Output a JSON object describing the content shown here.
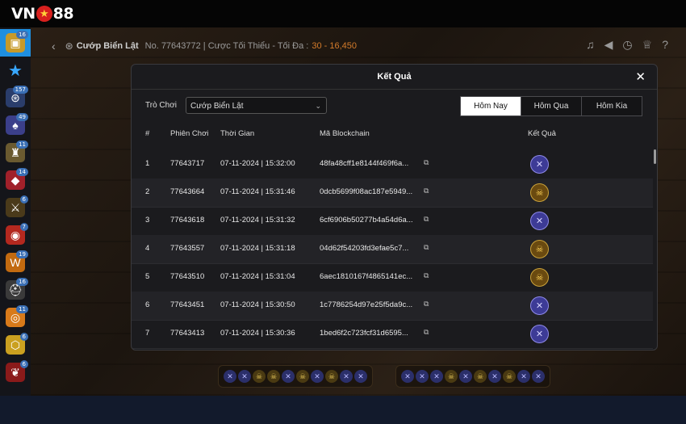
{
  "app": {
    "logo_left": "VN",
    "logo_right": "88"
  },
  "sidebar": {
    "items": [
      {
        "icon": "game-chest-icon",
        "badge": "16",
        "active": true
      },
      {
        "icon": "star-icon",
        "badge": "",
        "active": false
      },
      {
        "icon": "gamepad-icon",
        "badge": "157",
        "active": false
      },
      {
        "icon": "card-game-icon",
        "badge": "49",
        "active": false
      },
      {
        "icon": "warrior-icon",
        "badge": "11",
        "active": false
      },
      {
        "icon": "diamond-game-icon",
        "badge": "14",
        "active": false
      },
      {
        "icon": "battle-game-icon",
        "badge": "6",
        "active": false
      },
      {
        "icon": "dota-icon",
        "badge": "7",
        "active": false
      },
      {
        "icon": "warcraft-icon",
        "badge": "19",
        "active": false
      },
      {
        "icon": "pubg-icon",
        "badge": "16",
        "active": false
      },
      {
        "icon": "overwatch-icon",
        "badge": "11",
        "active": false
      },
      {
        "icon": "rainbow-six-icon",
        "badge": "6",
        "active": false
      },
      {
        "icon": "dragon-icon",
        "badge": "6",
        "active": false
      }
    ]
  },
  "game_header": {
    "game_name": "Cướp Biển Lật",
    "session_text": "No. 77643772 | Cược Tối Thiểu - Tối Đa :",
    "bet_range": "30 - 16,450"
  },
  "modal": {
    "title": "Kết Quả",
    "filter_label": "Trò Chơi",
    "selected_game": "Cướp Biển Lật",
    "tabs": [
      {
        "label": "Hôm Nay",
        "active": true
      },
      {
        "label": "Hôm Qua",
        "active": false
      },
      {
        "label": "Hôm Kia",
        "active": false
      }
    ],
    "columns": {
      "idx": "#",
      "session": "Phiên Chơi",
      "time": "Thời Gian",
      "hash": "Mã Blockchain",
      "result": "Kết Quả"
    },
    "rows": [
      {
        "idx": "1",
        "session": "77643717",
        "time": "07-11-2024 | 15:32:00",
        "hash": "48fa48cff1e8144f469f6a...",
        "result": "swords"
      },
      {
        "idx": "2",
        "session": "77643664",
        "time": "07-11-2024 | 15:31:46",
        "hash": "0dcb5699f08ac187e5949...",
        "result": "skull"
      },
      {
        "idx": "3",
        "session": "77643618",
        "time": "07-11-2024 | 15:31:32",
        "hash": "6cf6906b50277b4a54d6a...",
        "result": "swords"
      },
      {
        "idx": "4",
        "session": "77643557",
        "time": "07-11-2024 | 15:31:18",
        "hash": "04d62f54203fd3efae5c7...",
        "result": "skull"
      },
      {
        "idx": "5",
        "session": "77643510",
        "time": "07-11-2024 | 15:31:04",
        "hash": "6aec1810167f4865141ec...",
        "result": "skull"
      },
      {
        "idx": "6",
        "session": "77643451",
        "time": "07-11-2024 | 15:30:50",
        "hash": "1c7786254d97e25f5da9c...",
        "result": "swords"
      },
      {
        "idx": "7",
        "session": "77643413",
        "time": "07-11-2024 | 15:30:36",
        "hash": "1bed6f2c723fcf31d6595...",
        "result": "swords"
      }
    ]
  },
  "colors": {
    "accent_blue": "#1f8fe0",
    "orange": "#d47b2a",
    "swords": "#3d3b96",
    "skull": "#6a4a10"
  }
}
